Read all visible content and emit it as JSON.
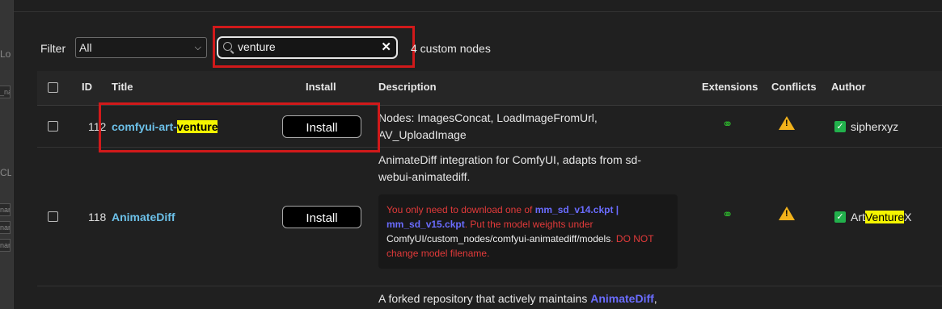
{
  "filter": {
    "label": "Filter",
    "selected": "All"
  },
  "search": {
    "value": "venture"
  },
  "result_count": "4 custom nodes",
  "columns": {
    "id": "ID",
    "title": "Title",
    "install": "Install",
    "description": "Description",
    "extensions": "Extensions",
    "conflicts": "Conflicts",
    "author": "Author"
  },
  "background_fragments": [
    "Lo",
    "_na",
    "CL",
    "nan",
    "nan",
    "nan"
  ],
  "rows": [
    {
      "id": "112",
      "title_prefix": "comfyui-art-",
      "title_match": "venture",
      "install_label": "Install",
      "description_line1": "Nodes: ImagesConcat, LoadImageFromUrl,",
      "description_line2": "AV_UploadImage",
      "author": "sipherxyz"
    },
    {
      "id": "118",
      "title": "AnimateDiff",
      "install_label": "Install",
      "description_line1": "AnimateDiff integration for ComfyUI, adapts from sd-",
      "description_line2": "webui-animatediff.",
      "note": {
        "text1": "You only need to download one of ",
        "link1": "mm_sd_v14.ckpt",
        "sep": " | ",
        "link2": "mm_sd_v15.ckpt",
        "text2": ". Put the model weights under",
        "path": "ComfyUI/custom_nodes/comfyui-animatediff/models",
        "text3": ". DO NOT",
        "text4": "change model filename."
      },
      "author_prefix": "Art",
      "author_match": "Venture",
      "author_suffix": "X"
    },
    {
      "description_prefix": "A forked repository that actively maintains ",
      "description_link": "AnimateDiff",
      "description_suffix": ","
    }
  ],
  "colors": {
    "highlight_box": "#d1191a",
    "search_match": "#f5f500",
    "title_link": "#6cc0e8",
    "extension_icon": "#2eb82e",
    "warning_icon": "#f2b21b",
    "checkbox_checked": "#22b14c"
  }
}
